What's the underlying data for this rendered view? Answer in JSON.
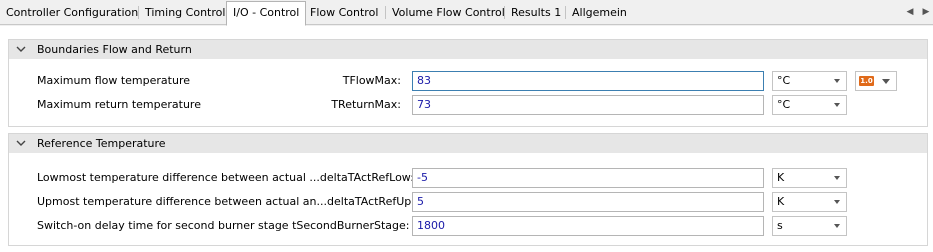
{
  "tabs": [
    {
      "label": "Controller Configuration"
    },
    {
      "label": "Timing Control"
    },
    {
      "label": "I/O - Control"
    },
    {
      "label": "Flow Control"
    },
    {
      "label": "Volume Flow Control"
    },
    {
      "label": "Results 1"
    },
    {
      "label": "Allgemein"
    }
  ],
  "active_tab": "I/O - Control",
  "sections": [
    {
      "title": "Boundaries Flow and Return",
      "rows": [
        {
          "label": "Maximum flow temperature",
          "var": "TFlowMax:",
          "value": "83",
          "unit": "°C"
        },
        {
          "label": "Maximum return temperature",
          "var": "TReturnMax:",
          "value": "73",
          "unit": "°C"
        }
      ],
      "badge": "1.0"
    },
    {
      "title": "Reference Temperature",
      "rows": [
        {
          "label": "Lowmost temperature difference between actual ...deltaTActRefLow:",
          "value": "-5",
          "unit": "K"
        },
        {
          "label": "Upmost temperature difference between actual an...deltaTActRefUp:",
          "value": "5",
          "unit": "K"
        },
        {
          "label": "Switch-on delay time for second burner stage  tSecondBurnerStage:",
          "value": "1800",
          "unit": "s"
        }
      ]
    }
  ]
}
